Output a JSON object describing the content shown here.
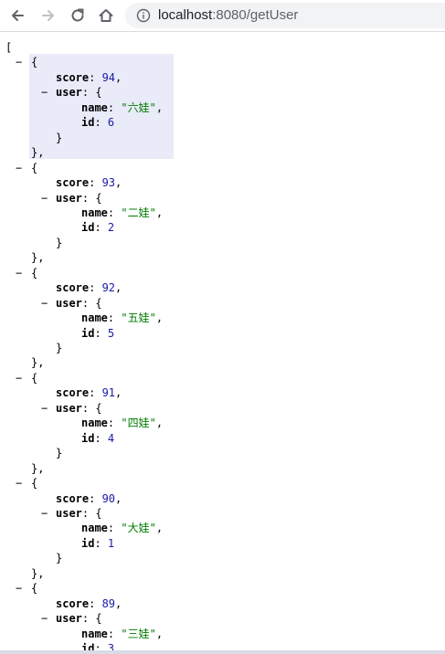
{
  "browser": {
    "url_host": "localhost",
    "url_port_path": ":8080/getUser"
  },
  "json": {
    "open_bracket": "[",
    "records": [
      {
        "score": "94",
        "name": "六娃",
        "id": "6"
      },
      {
        "score": "93",
        "name": "二娃",
        "id": "2"
      },
      {
        "score": "92",
        "name": "五娃",
        "id": "5"
      },
      {
        "score": "91",
        "name": "四娃",
        "id": "4"
      },
      {
        "score": "90",
        "name": "大娃",
        "id": "1"
      },
      {
        "score": "89",
        "name": "三娃",
        "id": "3"
      }
    ],
    "labels": {
      "score_key": "score",
      "user_key": "user",
      "name_key": "name",
      "id_key": "id",
      "collapse_toggle": "−"
    }
  }
}
